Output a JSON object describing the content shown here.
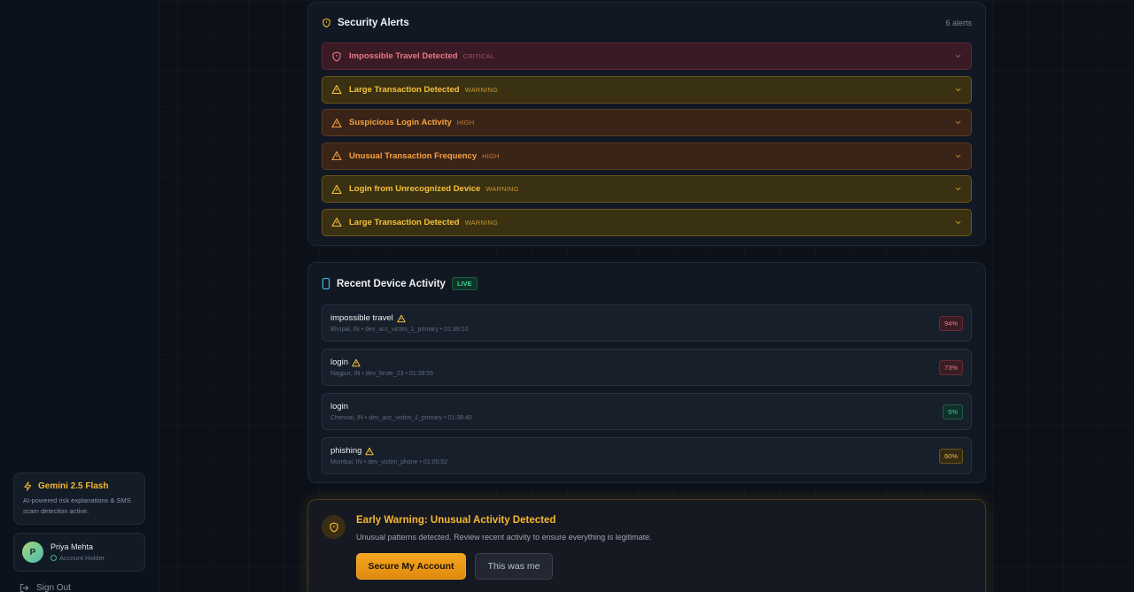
{
  "sidebar": {
    "gemini": {
      "title": "Gemini 2.5 Flash",
      "description": "AI-powered risk explanations & SMS scam detection active.",
      "icon": "lightning-icon"
    },
    "user": {
      "initial": "P",
      "name": "Priya Mehta",
      "role": "Account Holder"
    },
    "sign_out": "Sign Out"
  },
  "alerts": {
    "title": "Security Alerts",
    "count": "6 alerts",
    "items": [
      {
        "title": "Impossible Travel Detected",
        "severity": "CRITICAL"
      },
      {
        "title": "Large Transaction Detected",
        "severity": "WARNING"
      },
      {
        "title": "Suspicious Login Activity",
        "severity": "HIGH"
      },
      {
        "title": "Unusual Transaction Frequency",
        "severity": "HIGH"
      },
      {
        "title": "Login from Unrecognized Device",
        "severity": "WARNING"
      },
      {
        "title": "Large Transaction Detected",
        "severity": "WARNING"
      }
    ]
  },
  "devices": {
    "title": "Recent Device Activity",
    "badge": "LIVE",
    "items": [
      {
        "event": "impossible travel",
        "meta": "Bhopal, IN • dev_acc_victim_1_primary • 01:39:10",
        "score": "94%"
      },
      {
        "event": "login",
        "meta": "Nagpur, IN • dev_brute_23 • 01:38:55",
        "score": "73%"
      },
      {
        "event": "login",
        "meta": "Chennai, IN • dev_acc_victim_1_primary • 01:38:40",
        "score": "5%"
      },
      {
        "event": "phishing",
        "meta": "Mumbai, IN • dev_victim_phone • 01:05:52",
        "score": "60%"
      }
    ]
  },
  "early_warning": {
    "title": "Early Warning: Unusual Activity Detected",
    "description": "Unusual patterns detected. Review recent activity to ensure everything is legitimate.",
    "primary_button": "Secure My Account",
    "secondary_button": "This was me"
  },
  "colors": {
    "accent": "#f5b731",
    "critical": "#e8788a",
    "high": "#f6a23d",
    "success": "#3fd08f"
  }
}
